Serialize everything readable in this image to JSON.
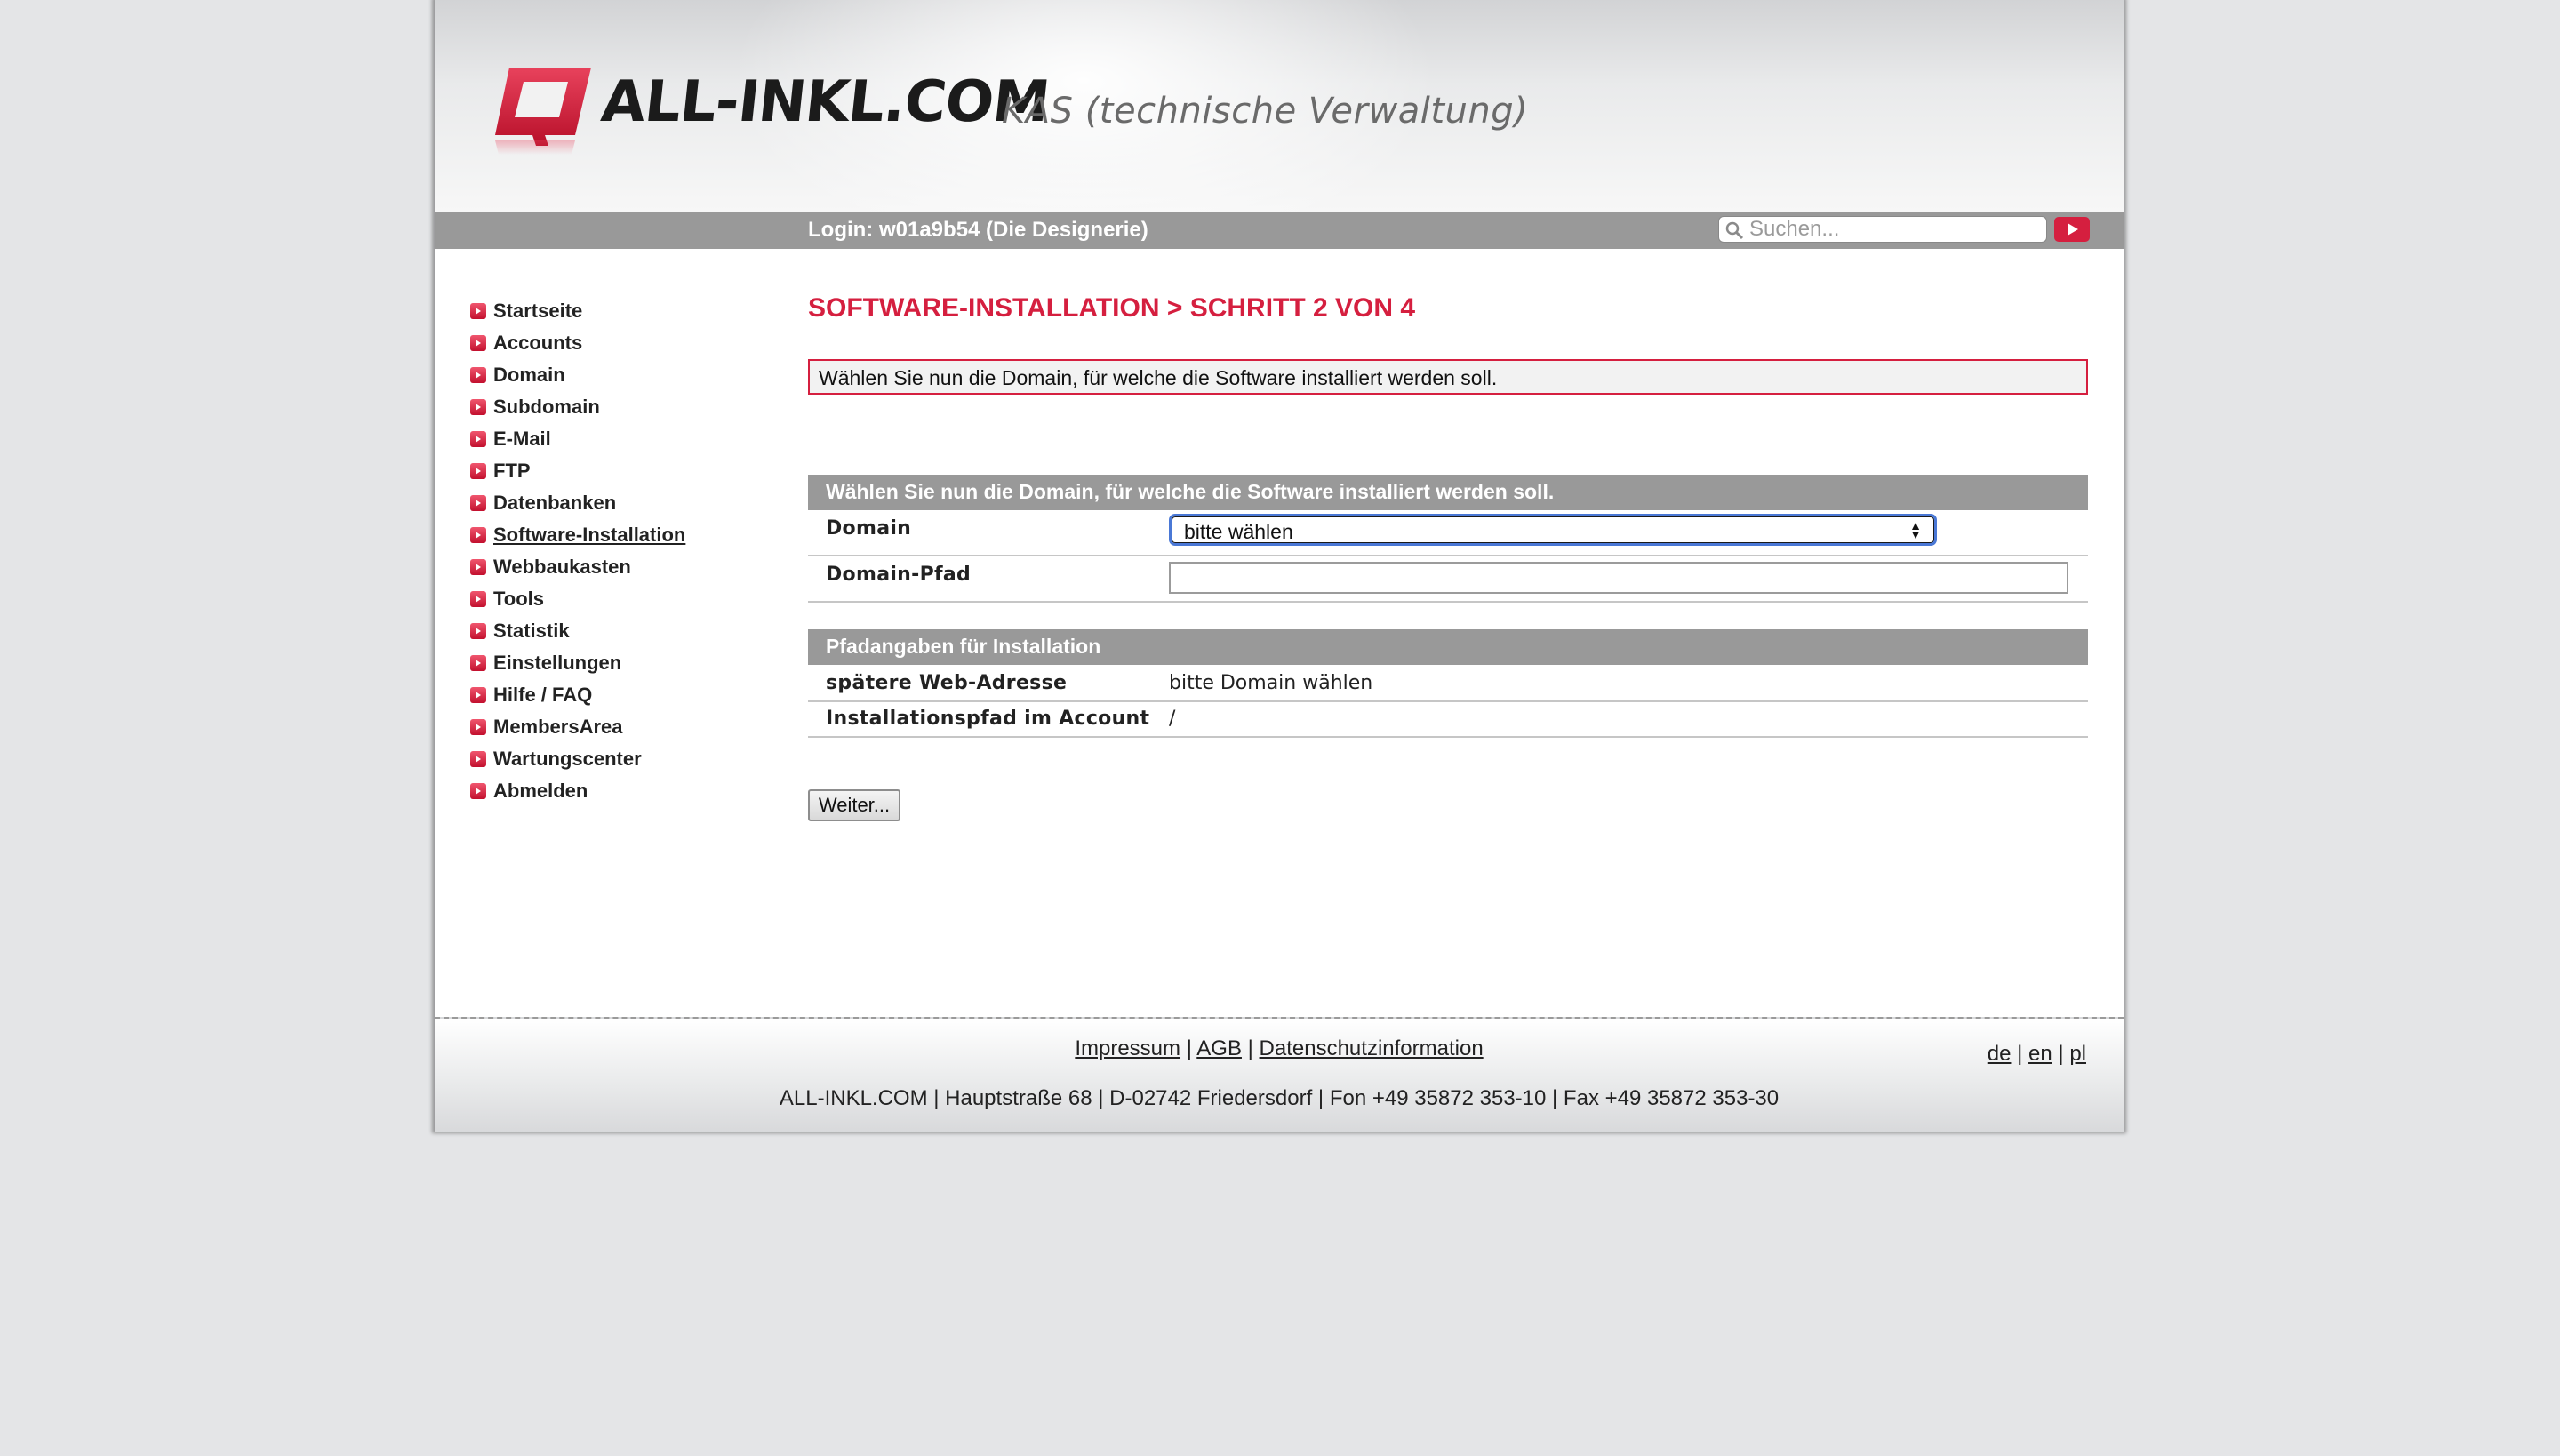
{
  "header": {
    "logo_text": "ALL-INKL.COM",
    "subtitle": "KAS (technische Verwaltung)"
  },
  "topbar": {
    "login_text": "Login: w01a9b54 (Die Designerie)",
    "search_placeholder": "Suchen..."
  },
  "sidebar": {
    "items": [
      {
        "label": "Startseite",
        "active": false
      },
      {
        "label": "Accounts",
        "active": false
      },
      {
        "label": "Domain",
        "active": false
      },
      {
        "label": "Subdomain",
        "active": false
      },
      {
        "label": "E-Mail",
        "active": false
      },
      {
        "label": "FTP",
        "active": false
      },
      {
        "label": "Datenbanken",
        "active": false
      },
      {
        "label": "Software-Installation",
        "active": true
      },
      {
        "label": "Webbaukasten",
        "active": false
      },
      {
        "label": "Tools",
        "active": false
      },
      {
        "label": "Statistik",
        "active": false
      },
      {
        "label": "Einstellungen",
        "active": false
      },
      {
        "label": "Hilfe / FAQ",
        "active": false
      },
      {
        "label": "MembersArea",
        "active": false
      },
      {
        "label": "Wartungscenter",
        "active": false
      },
      {
        "label": "Abmelden",
        "active": false
      }
    ]
  },
  "main": {
    "title": "SOFTWARE-INSTALLATION > SCHRITT 2 VON 4",
    "info_message": "Wählen Sie nun die Domain, für welche die Software installiert werden soll.",
    "section1": {
      "header": "Wählen Sie nun die Domain, für welche die Software installiert werden soll.",
      "domain_label": "Domain",
      "domain_selected": "bitte wählen",
      "domain_path_label": "Domain-Pfad",
      "domain_path_value": ""
    },
    "section2": {
      "header": "Pfadangaben für Installation",
      "web_address_label": "spätere Web-Adresse",
      "web_address_value": "bitte Domain wählen",
      "install_path_label": "Installationspfad im Account",
      "install_path_value": "/"
    },
    "next_button": "Weiter..."
  },
  "footer": {
    "links": [
      "Impressum",
      "AGB",
      "Datenschutzinformation"
    ],
    "separator": "|",
    "address": "ALL-INKL.COM | Hauptstraße 68 | D-02742 Friedersdorf | Fon +49 35872 353-10 | Fax +49 35872 353-30",
    "languages": [
      "de",
      "en",
      "pl"
    ]
  },
  "colors": {
    "accent": "#d51f3f",
    "bar": "#999999",
    "background": "#e4e5e7"
  }
}
